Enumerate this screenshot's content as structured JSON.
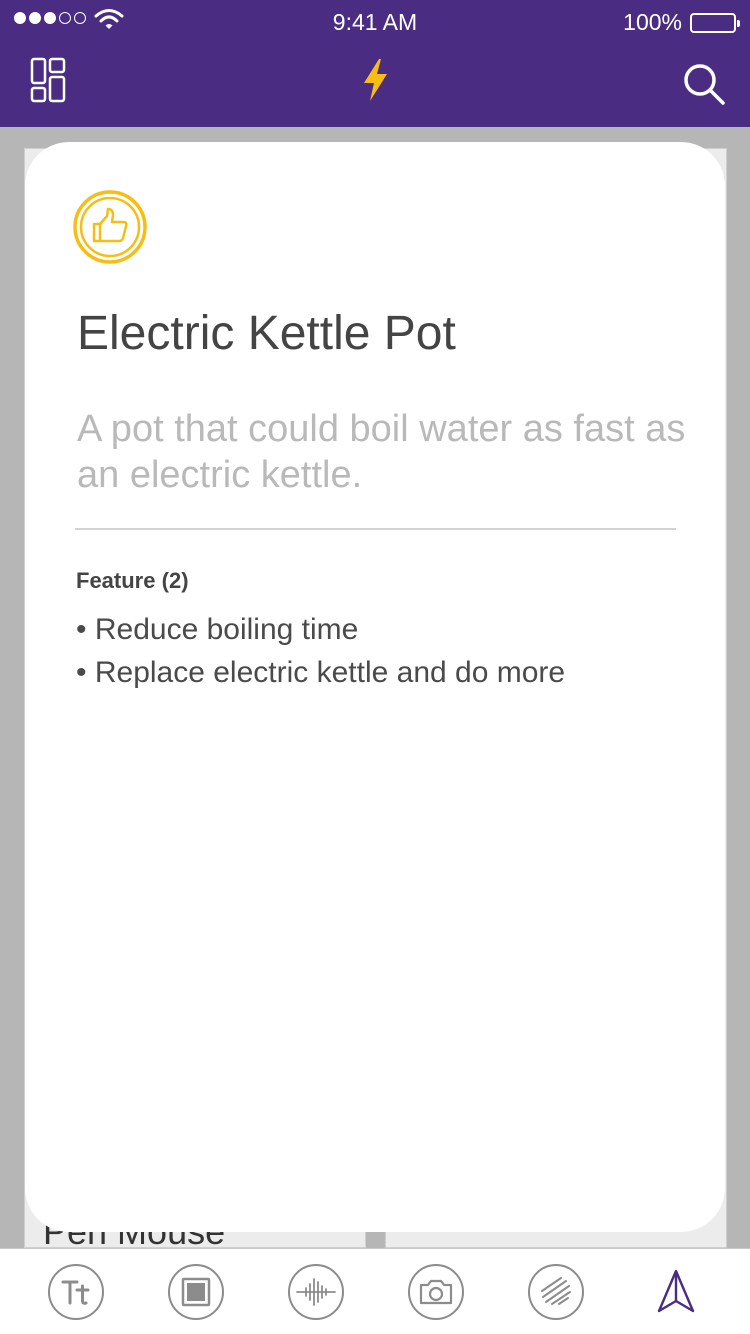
{
  "status_bar": {
    "time": "9:41 AM",
    "battery_percent": "100%",
    "battery_level": 1.0,
    "signal_bars_filled": 3,
    "signal_bars_total": 5
  },
  "nav": {
    "left_icon": "layout-grid-icon",
    "center_icon": "lightning-bolt-icon",
    "right_icon": "search-icon"
  },
  "background_card": {
    "title": "Pen Mouse"
  },
  "card": {
    "badge_icon": "thumbs-up-icon",
    "title": "Electric Kettle Pot",
    "description": "A pot that could boil water as fast as an electric kettle.",
    "feature_label": "Feature",
    "feature_count": "2",
    "features": [
      "Reduce boiling time",
      "Replace electric kettle and do more"
    ]
  },
  "toolbar": {
    "items": [
      "text-format-icon",
      "square-frame-icon",
      "audio-wave-icon",
      "camera-icon",
      "scribble-icon",
      "send-icon"
    ]
  },
  "colors": {
    "brand": "#4a2d82",
    "accent": "#f8bd15",
    "toolbar_icon": "#8c8c8c"
  }
}
